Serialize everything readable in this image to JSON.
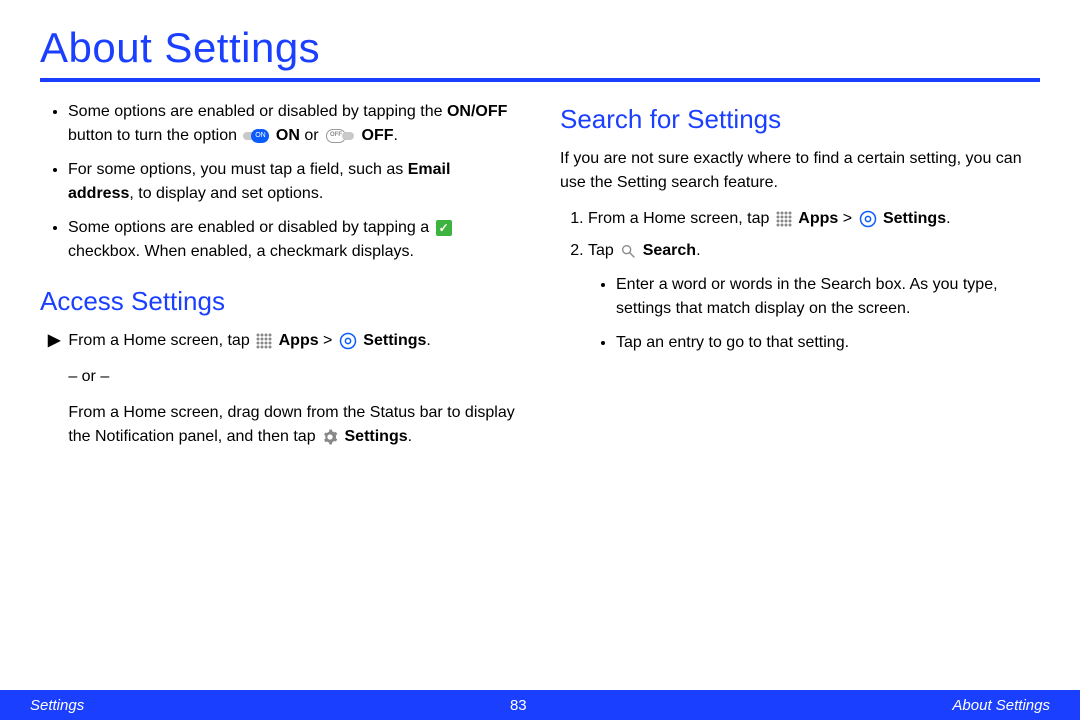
{
  "page": {
    "title": "About Settings",
    "footer_left": "Settings",
    "footer_page": "83",
    "footer_right": "About Settings"
  },
  "left": {
    "bullet1_a": "Some options are enabled or disabled by tapping the ",
    "bullet1_b": "ON/OFF",
    "bullet1_c": " button to turn the option ",
    "bullet1_on": "ON",
    "bullet1_d": " or ",
    "bullet1_off": "OFF",
    "bullet1_e": ".",
    "bullet2_a": "For some options, you must tap a field, such as ",
    "bullet2_b": "Email address",
    "bullet2_c": ", to display and set options.",
    "bullet3_a": "Some options are enabled or disabled by tapping a ",
    "bullet3_b": " checkbox. When enabled, a checkmark displays.",
    "heading": "Access Settings",
    "step_a": "From a Home screen, tap ",
    "step_apps": "Apps",
    "step_gt": " > ",
    "step_settings": "Settings",
    "step_dot": ".",
    "or": "– or –",
    "alt_a": "From a Home screen, drag down from the Status bar to display the Notification panel, and then tap ",
    "alt_settings": "Settings",
    "alt_dot": "."
  },
  "right": {
    "heading": "Search for Settings",
    "intro": "If you are not sure exactly where to find a certain setting, you can use the Setting search feature.",
    "step1_a": "From a Home screen, tap ",
    "step1_apps": "Apps",
    "step1_gt": " > ",
    "step1_settings": "Settings",
    "step1_dot": ".",
    "step2_a": "Tap ",
    "step2_search": "Search",
    "step2_dot": ".",
    "sub1": "Enter a word or words in the Search box. As you type, settings that match display on the screen.",
    "sub2": "Tap an entry to go to that setting."
  }
}
